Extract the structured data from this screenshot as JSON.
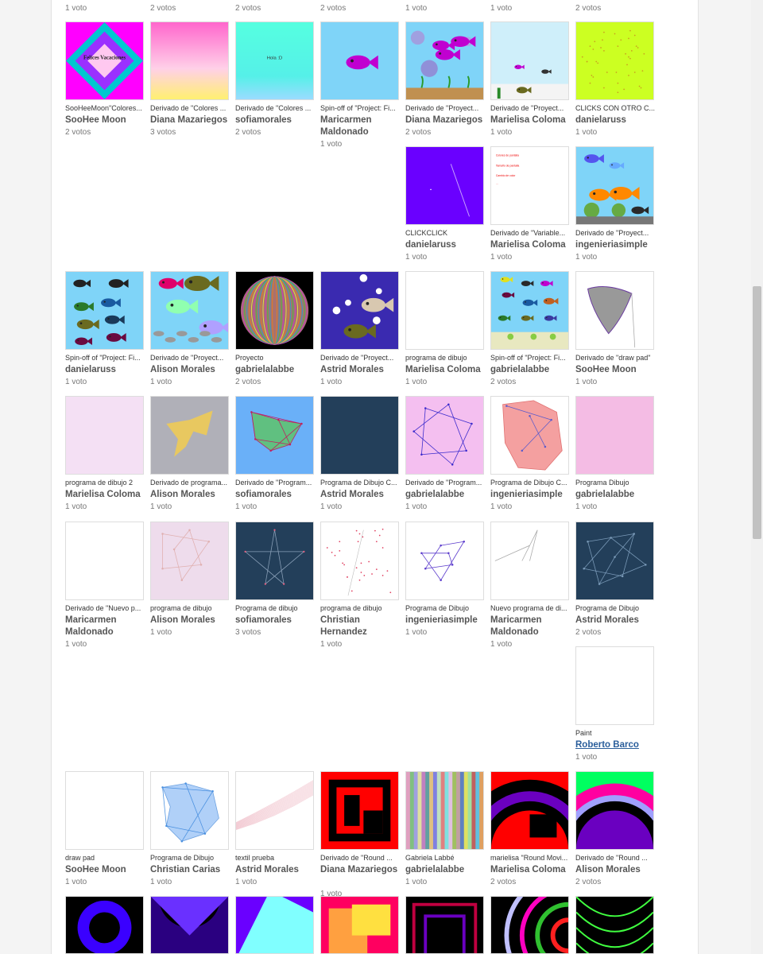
{
  "top_votes": [
    "1 voto",
    "2 votos",
    "2 votos",
    "2 votos",
    "1 voto",
    "1 voto",
    "2 votos"
  ],
  "cards": [
    {
      "title": "SooHeeMoon\"Colores...",
      "author": "SooHee Moon",
      "votes": "2 votos"
    },
    {
      "title": "Derivado de \"Colores ...",
      "author": "Diana Mazariegos",
      "votes": "3 votos"
    },
    {
      "title": "Derivado de \"Colores ...",
      "author": "sofiamorales",
      "votes": "2 votos"
    },
    {
      "title": "Spin-off of \"Project: Fi...",
      "author": "Maricarmen Maldonado",
      "votes": "1 voto"
    },
    {
      "title": "Derivado de \"Proyect...",
      "author": "Diana Mazariegos",
      "votes": "2 votos"
    },
    {
      "title": "Derivado de \"Proyect...",
      "author": "Marielisa Coloma",
      "votes": "1 voto"
    },
    {
      "title": "CLICKS CON OTRO C...",
      "author": "danielaruss",
      "votes": "1 voto"
    },
    {
      "title": "CLICKCLICK",
      "author": "danielaruss",
      "votes": "1 voto"
    },
    {
      "title": "Derivado de \"Variable...",
      "author": "Marielisa Coloma",
      "votes": "1 voto"
    },
    {
      "title": "Derivado de \"Proyect...",
      "author": "ingenieriasimple",
      "votes": "1 voto"
    },
    {
      "title": "Spin-off of \"Project: Fi...",
      "author": "danielaruss",
      "votes": "1 voto"
    },
    {
      "title": "Derivado de \"Proyect...",
      "author": "Alison Morales",
      "votes": "1 voto"
    },
    {
      "title": "Proyecto",
      "author": "gabrielalabbe",
      "votes": "2 votos"
    },
    {
      "title": "Derivado de \"Proyect...",
      "author": "Astrid Morales",
      "votes": "1 voto"
    },
    {
      "title": "programa de dibujo",
      "author": "Marielisa Coloma",
      "votes": "1 voto"
    },
    {
      "title": "Spin-off of \"Project: Fi...",
      "author": "gabrielalabbe",
      "votes": "2 votos"
    },
    {
      "title": "Derivado de \"draw pad\"",
      "author": "SooHee Moon",
      "votes": "1 voto"
    },
    {
      "title": "programa de dibujo 2",
      "author": "Marielisa Coloma",
      "votes": "1 voto"
    },
    {
      "title": "Derivado de programa...",
      "author": "Alison Morales",
      "votes": "1 voto"
    },
    {
      "title": "Derivado de \"Program...",
      "author": "sofiamorales",
      "votes": "1 voto"
    },
    {
      "title": "Programa de Dibujo C...",
      "author": "Astrid Morales",
      "votes": "1 voto"
    },
    {
      "title": "Derivado de \"Program...",
      "author": "gabrielalabbe",
      "votes": "1 voto"
    },
    {
      "title": "Programa de Dibujo C...",
      "author": "ingenieriasimple",
      "votes": "1 voto"
    },
    {
      "title": "Programa Dibujo",
      "author": "gabrielalabbe",
      "votes": "1 voto"
    },
    {
      "title": "Derivado de \"Nuevo p...",
      "author": "Maricarmen Maldonado",
      "votes": "1 voto"
    },
    {
      "title": "programa de dibujo",
      "author": "Alison Morales",
      "votes": "1 voto"
    },
    {
      "title": "Programa de dibujo",
      "author": "sofiamorales",
      "votes": "3 votos"
    },
    {
      "title": "programa de dibujo",
      "author": "Christian Hernandez",
      "votes": "1 voto"
    },
    {
      "title": "Programa de Dibujo",
      "author": "ingenieriasimple",
      "votes": "1 voto"
    },
    {
      "title": "Nuevo programa de di...",
      "author": "Maricarmen Maldonado",
      "votes": "1 voto"
    },
    {
      "title": "Programa de Dibujo",
      "author": "Astrid Morales",
      "votes": "2 votos"
    },
    {
      "title": "Paint",
      "author": "Roberto Barco",
      "votes": "1 voto"
    },
    {
      "title": "draw pad",
      "author": "SooHee Moon",
      "votes": "1 voto"
    },
    {
      "title": "Programa de Dibujo",
      "author": "Christian Carias",
      "votes": "1 voto"
    },
    {
      "title": "textil prueba",
      "author": "Astrid Morales",
      "votes": "1 voto"
    },
    {
      "title": "Derivado de \"Round ...",
      "author": "Diana Mazariegos",
      "votes": "1 voto"
    },
    {
      "title": "Gabriela Labbé",
      "author": "gabrielalabbe",
      "votes": "1 voto"
    },
    {
      "title": "marielisa \"Round Movi...",
      "author": "Marielisa Coloma",
      "votes": "2 votos"
    },
    {
      "title": "Derivado de \"Round ...",
      "author": "Alison Morales",
      "votes": "2 votos"
    }
  ],
  "thumb_text": {
    "vacaciones": "Felices Vacaciones",
    "hola": "Hola :D"
  }
}
